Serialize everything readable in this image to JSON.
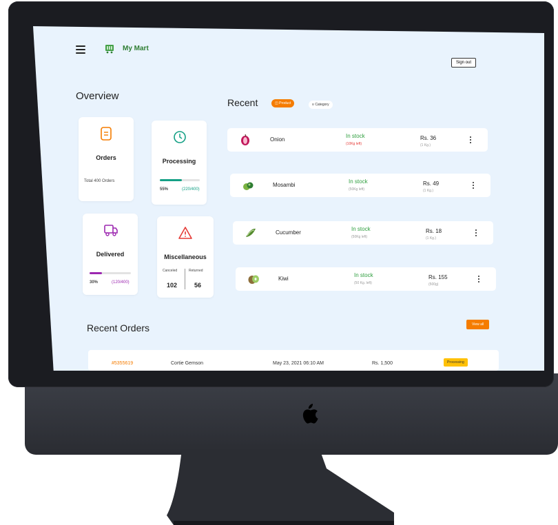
{
  "app": {
    "name": "My Mart",
    "signout_label": "Sign out"
  },
  "overview": {
    "title": "Overview",
    "cards": {
      "orders": {
        "title": "Orders",
        "sub": "Total 400 Orders"
      },
      "processing": {
        "title": "Processing",
        "progress": 0.55,
        "percent": "55%",
        "count": "(220/400)"
      },
      "delivered": {
        "title": "Delivered",
        "progress": 0.3,
        "percent": "30%",
        "count": "(120/400)"
      },
      "misc": {
        "title": "Miscellaneous",
        "canceled_label": "Canceled",
        "returned_label": "Returned",
        "canceled": "102",
        "returned": "56"
      }
    }
  },
  "recent": {
    "title": "Recent",
    "tabs": [
      {
        "label": "Product",
        "active": true
      },
      {
        "label": "Category",
        "active": false
      }
    ],
    "items": [
      {
        "name": "Onion",
        "status": "In stock",
        "stock": "(10Kg left)",
        "price": "Rs. 36",
        "unit": "(1 Kg.)",
        "icon": "onion-icon",
        "low": true
      },
      {
        "name": "Mosambi",
        "status": "In stock",
        "stock": "(50Kg left)",
        "price": "Rs. 49",
        "unit": "(1 Kg.)",
        "icon": "mosambi-icon",
        "low": false
      },
      {
        "name": "Cucumber",
        "status": "In stock",
        "stock": "(50Kg left)",
        "price": "Rs. 18",
        "unit": "(1 Kg.)",
        "icon": "cucumber-icon",
        "low": false
      },
      {
        "name": "Kiwi",
        "status": "In stock",
        "stock": "(50 Kg. left)",
        "price": "Rs. 155",
        "unit": "(500g)",
        "icon": "kiwi-icon",
        "low": false
      }
    ]
  },
  "recent_orders": {
    "title": "Recent Orders",
    "view_all_label": "View all",
    "rows": [
      {
        "id": "#5355619",
        "customer": "Cortie Gemson",
        "date": "May 23, 2021 06:10 AM",
        "amount": "Rs. 1,500",
        "status": "Processing"
      }
    ]
  },
  "colors": {
    "accent": "#f57c00",
    "green": "#2e9e3e",
    "teal": "#14a085",
    "purple": "#9c27b0",
    "red": "#e53935",
    "screen_bg": "#e9f3fd"
  }
}
